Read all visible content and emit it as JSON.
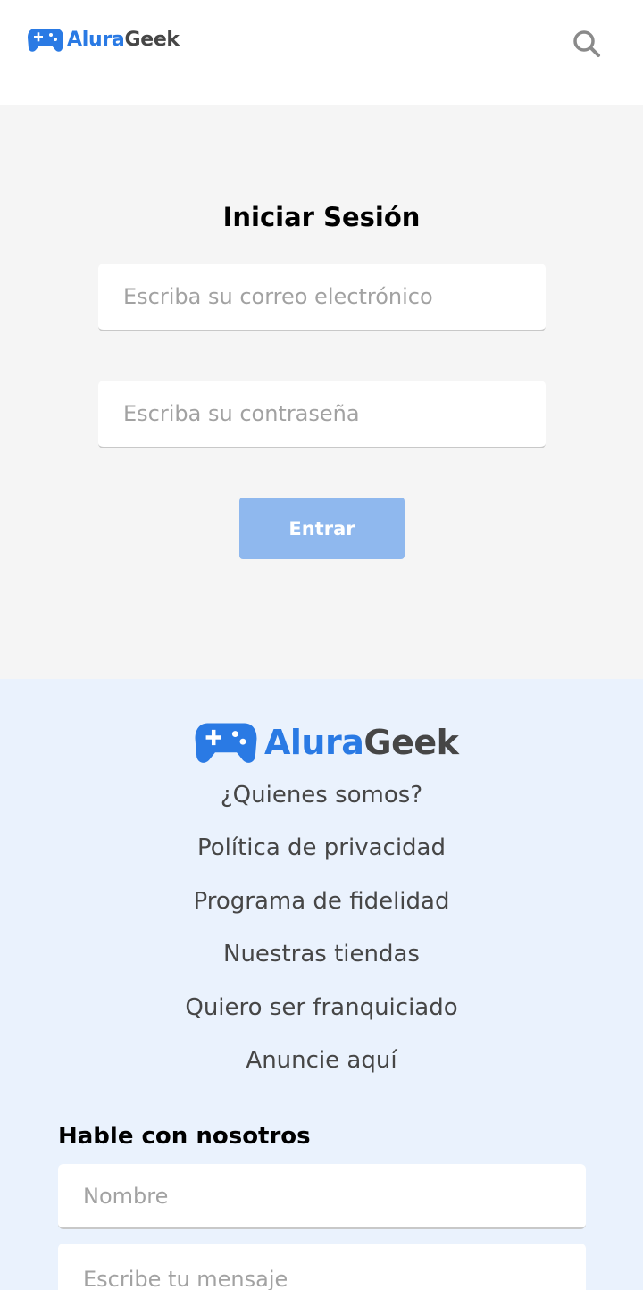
{
  "brand": {
    "part1": "Alura",
    "part2": "Geek",
    "color_primary": "#2a7ae4",
    "color_secondary": "#464646"
  },
  "header": {
    "logo_icon": "gamepad-icon",
    "search_icon": "search-icon"
  },
  "login": {
    "title": "Iniciar Sesión",
    "email_placeholder": "Escriba su correo electrónico",
    "password_placeholder": "Escriba su contraseña",
    "submit_label": "Entrar",
    "submit_color": "#8fb8ee",
    "background": "#f5f5f5"
  },
  "footer": {
    "background": "#eaf2fd",
    "links": [
      "¿Quienes somos?",
      "Política de privacidad",
      "Programa de fidelidad",
      "Nuestras tiendas",
      "Quiero ser franquiciado",
      "Anuncie aquí"
    ],
    "contact": {
      "title": "Hable con nosotros",
      "name_placeholder": "Nombre",
      "message_placeholder": "Escribe tu mensaje"
    }
  }
}
